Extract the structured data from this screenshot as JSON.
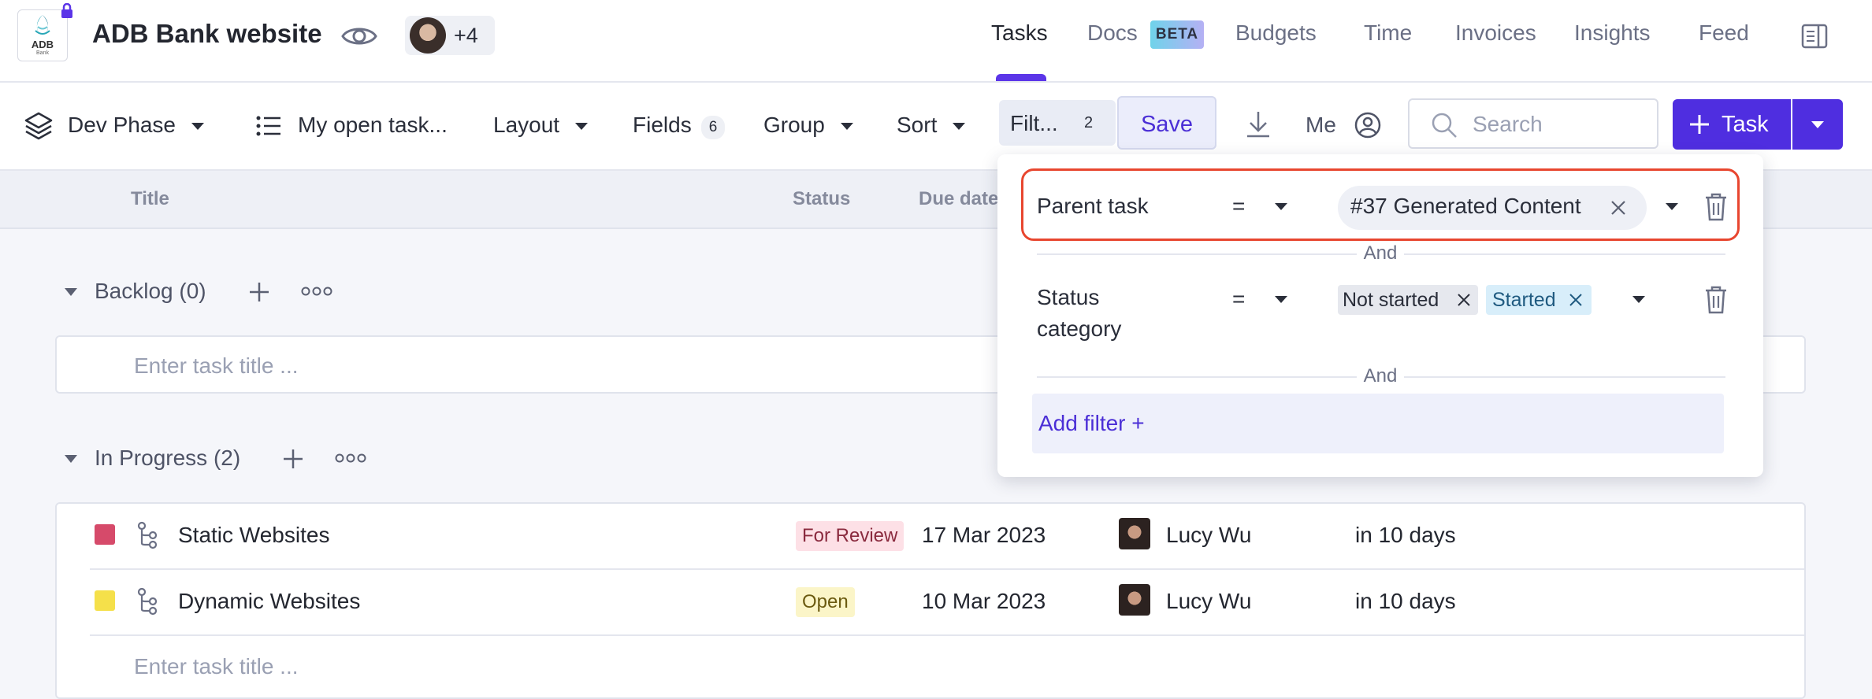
{
  "header": {
    "logo_text": "ADB",
    "logo_subtext": "Bank",
    "project_title": "ADB Bank website",
    "members_more": "+4",
    "nav": [
      {
        "label": "Tasks",
        "active": true
      },
      {
        "label": "Docs",
        "badge": "BETA"
      },
      {
        "label": "Budgets"
      },
      {
        "label": "Time"
      },
      {
        "label": "Invoices"
      },
      {
        "label": "Insights"
      },
      {
        "label": "Feed"
      }
    ]
  },
  "toolbar": {
    "phase_label": "Dev Phase",
    "view_label": "My open task...",
    "layout_label": "Layout",
    "fields_label": "Fields",
    "fields_count": "6",
    "group_label": "Group",
    "sort_label": "Sort",
    "filter_label": "Filt...",
    "filter_count": "2",
    "save_label": "Save",
    "me_label": "Me",
    "search_placeholder": "Search",
    "task_button_label": "Task"
  },
  "table": {
    "columns": [
      "Title",
      "Status",
      "Due date"
    ]
  },
  "groups": [
    {
      "title": "Backlog (0)",
      "enter_placeholder": "Enter task title ..."
    },
    {
      "title": "In Progress (2)",
      "enter_placeholder": "Enter task title ..."
    }
  ],
  "tasks": [
    {
      "name": "Static Websites",
      "status": "For Review",
      "status_color": "#fde0e6",
      "status_text_color": "#8a2a3e",
      "swatch": "#d64a6a",
      "due": "17 Mar 2023",
      "assignee": "Lucy Wu",
      "remaining": "in 10 days"
    },
    {
      "name": "Dynamic Websites",
      "status": "Open",
      "status_color": "#fbf5c8",
      "status_text_color": "#6b5a10",
      "swatch": "#f5e04a",
      "due": "10 Mar 2023",
      "assignee": "Lucy Wu",
      "remaining": "in 10 days"
    }
  ],
  "filters": {
    "rows": [
      {
        "field": "Parent task",
        "operator": "=",
        "values": [
          "#37 Generated Content"
        ]
      },
      {
        "field_line1": "Status",
        "field_line2": "category",
        "operator": "=",
        "values": [
          "Not started",
          "Started"
        ]
      }
    ],
    "connector": "And",
    "add_filter_label": "Add filter +"
  },
  "colors": {
    "accent": "#4f2ee0",
    "highlight": "#e8462f"
  }
}
